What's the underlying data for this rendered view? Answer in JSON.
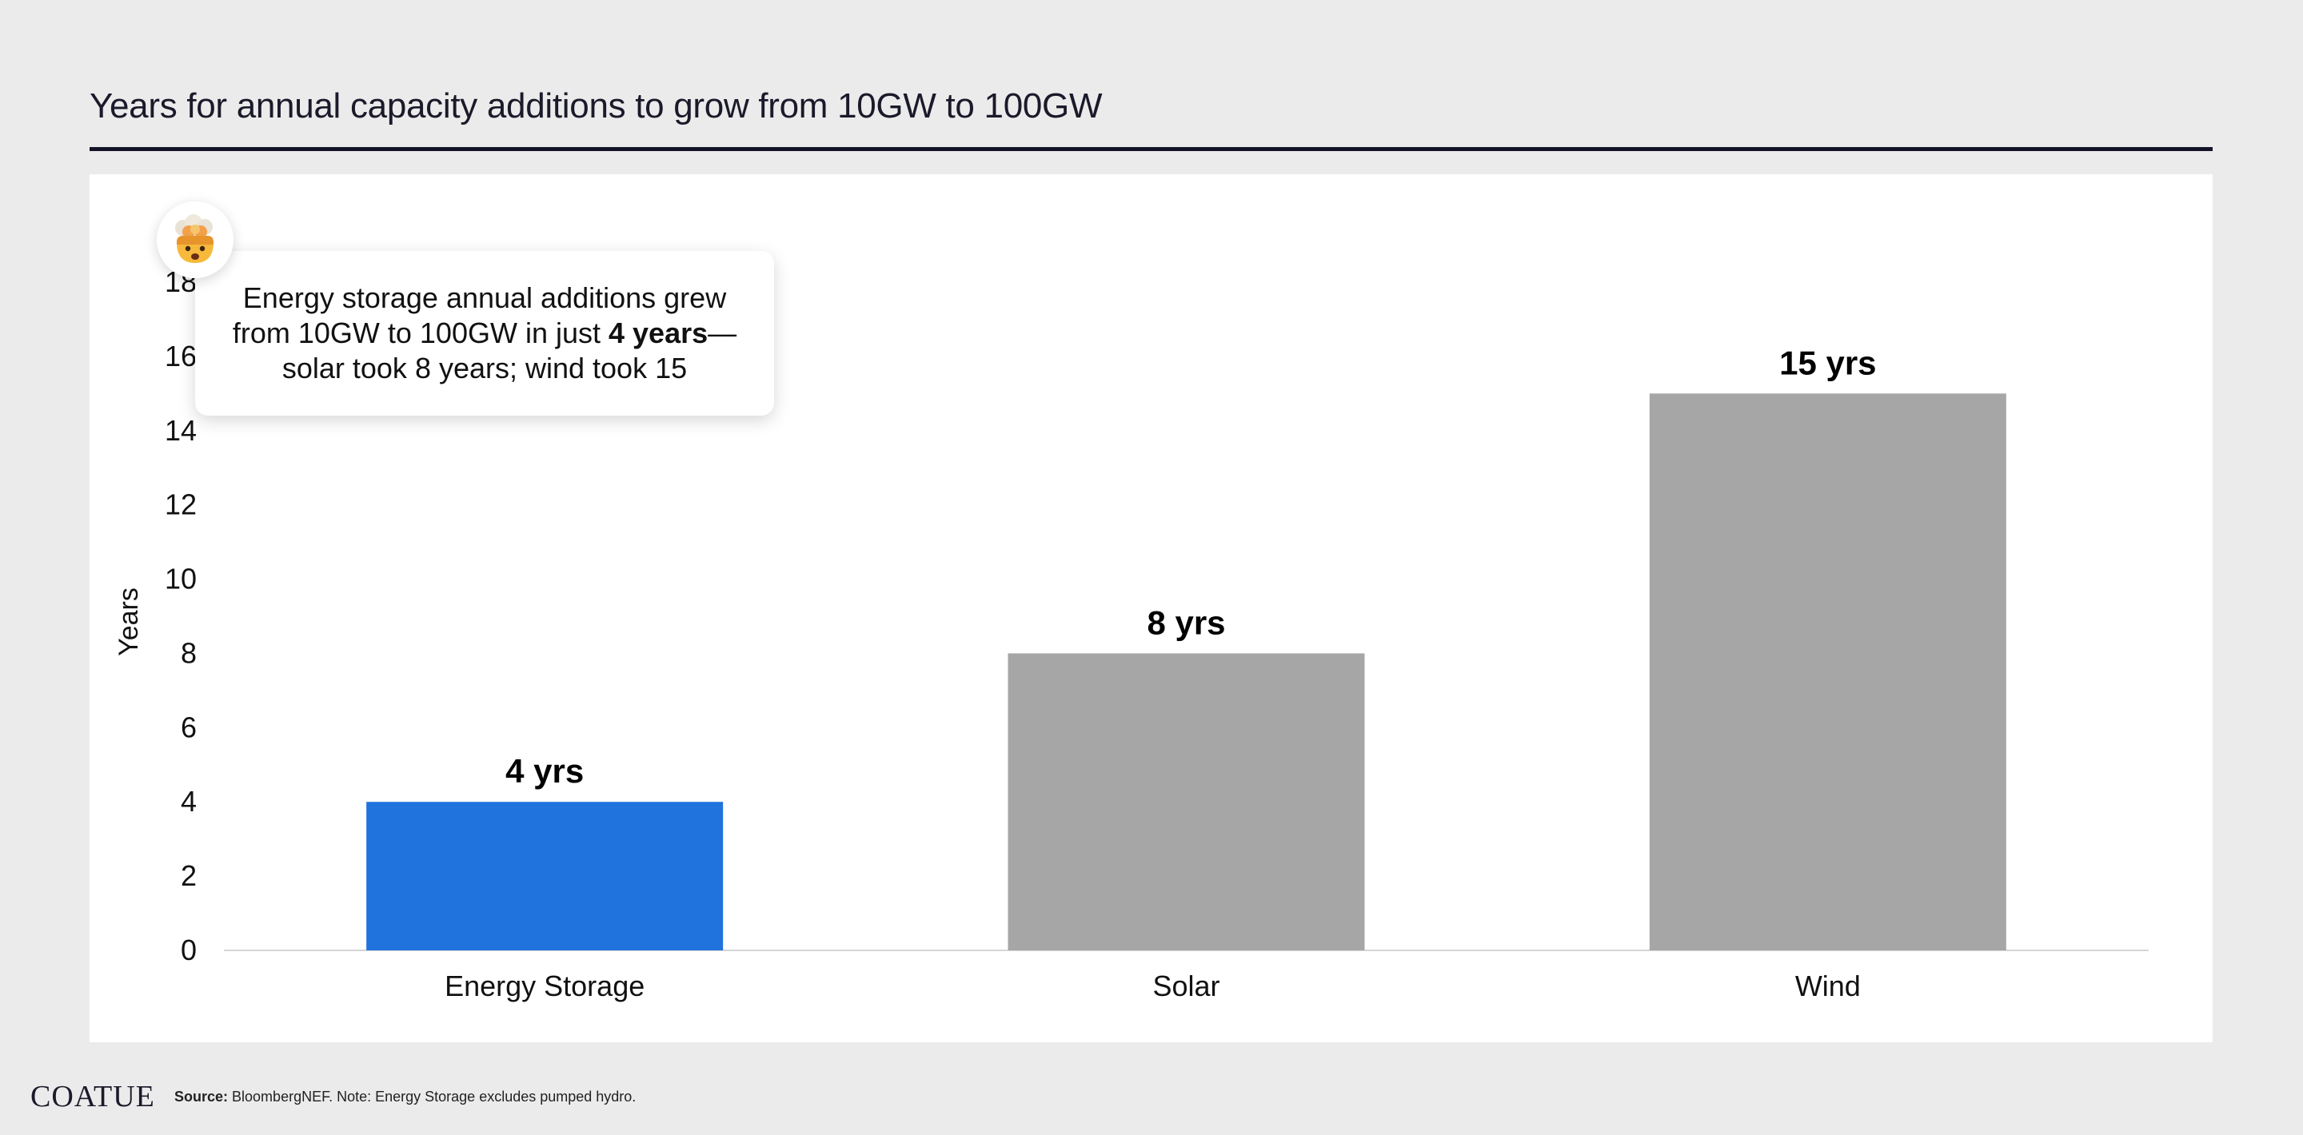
{
  "header": {
    "title": "Years for annual capacity additions to grow from 10GW to 100GW"
  },
  "chart_data": {
    "type": "bar",
    "title": "",
    "xlabel": "",
    "ylabel": "Years",
    "categories": [
      "Energy Storage",
      "Solar",
      "Wind"
    ],
    "values": [
      4,
      8,
      15
    ],
    "data_labels": [
      "4 yrs",
      "8 yrs",
      "15 yrs"
    ],
    "bar_colors": [
      "#2072dd",
      "#a6a6a6",
      "#a6a6a6"
    ],
    "ylim": [
      0,
      18
    ],
    "yticks": [
      0,
      2,
      4,
      6,
      8,
      10,
      12,
      14,
      16,
      18
    ],
    "grid": false,
    "legend": "none"
  },
  "callout": {
    "line1": "Energy storage annual additions grew",
    "line2_start": "from 10GW to 100GW in just ",
    "line2_bold": "4 years",
    "line2_end": "—",
    "line3": "solar took 8 years; wind took 15",
    "icon": "exploding-head-icon"
  },
  "footer": {
    "logo": "COATUE",
    "source_label": "Source:",
    "source_text": " BloombergNEF. Note: Energy Storage excludes pumped hydro."
  },
  "colors": {
    "background": "#ebebeb",
    "panel": "#ffffff",
    "accent": "#2072dd",
    "bar_neutral": "#a6a6a6",
    "rule": "#141428"
  }
}
